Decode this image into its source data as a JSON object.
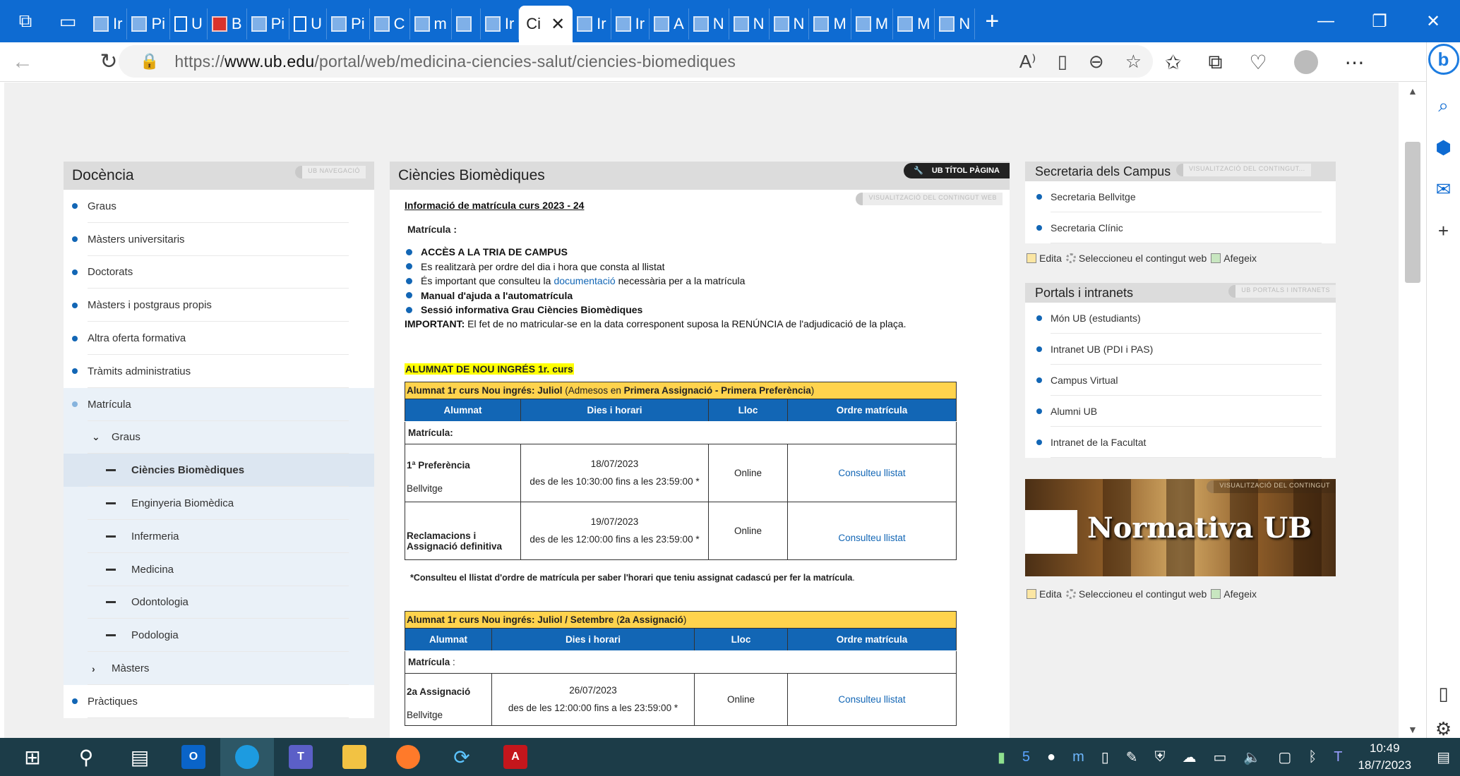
{
  "browser": {
    "tabs": [
      {
        "label": "Ir",
        "icon": "ub"
      },
      {
        "label": "Pi",
        "icon": "ub"
      },
      {
        "label": "U",
        "icon": "doc"
      },
      {
        "label": "B",
        "icon": "pdf"
      },
      {
        "label": "Pi",
        "icon": "ub"
      },
      {
        "label": "U",
        "icon": "doc"
      },
      {
        "label": "Pi",
        "icon": "ub"
      },
      {
        "label": "C",
        "icon": "app"
      },
      {
        "label": "m",
        "icon": "ub"
      },
      {
        "label": "",
        "icon": "ub"
      },
      {
        "label": "Ir",
        "icon": "ub"
      }
    ],
    "active_tab": {
      "label": "Ci",
      "close": "✕"
    },
    "tabs_after": [
      {
        "label": "Ir",
        "icon": "ub"
      },
      {
        "label": "Ir",
        "icon": "ub"
      },
      {
        "label": "A",
        "icon": "ub"
      },
      {
        "label": "N",
        "icon": "ub"
      },
      {
        "label": "N",
        "icon": "ub"
      },
      {
        "label": "N",
        "icon": "ub"
      },
      {
        "label": "M",
        "icon": "ub"
      },
      {
        "label": "M",
        "icon": "ub"
      },
      {
        "label": "M",
        "icon": "ub"
      },
      {
        "label": "N",
        "icon": "ub"
      }
    ],
    "url_domain": "www.ub.edu",
    "url_prefix": "https://",
    "url_path": "/portal/web/medicina-ciencies-salut/ciencies-biomediques"
  },
  "left": {
    "title": "Docència",
    "tag": "UB NAVEGACIÓ",
    "items": [
      {
        "label": "Graus"
      },
      {
        "label": "Màsters universitaris"
      },
      {
        "label": "Doctorats"
      },
      {
        "label": "Màsters i postgraus propis"
      },
      {
        "label": "Altra oferta formativa"
      },
      {
        "label": "Tràmits administratius"
      },
      {
        "label": "Matrícula"
      }
    ],
    "sub_graus": "Graus",
    "sub2": [
      "Ciències Biomèdiques",
      "Enginyeria Biomèdica",
      "Infermeria",
      "Medicina",
      "Odontologia",
      "Podologia"
    ],
    "sub_masters": "Màsters",
    "practiques": "Pràctiques"
  },
  "center": {
    "title": "Ciències Biomèdiques",
    "title_tag": "UB TÍTOL PÀGINA",
    "content_tag": "VISUALITZACIÓ DEL CONTINGUT WEB",
    "info_title": "Informació de matrícula curs 2023 - 24",
    "matricula_label": "Matrícula :",
    "bullets": {
      "b1": "ACCÈS A LA TRIA DE CAMPUS",
      "b2": "Es realitzarà per ordre del dia i hora que consta al llistat",
      "b3_pre": "És important que consulteu la",
      "b3_link": "documentació",
      "b3_post": "necessària per a la matrícula",
      "b4": "Manual d'ajuda a l'automatrícula",
      "b5": "Sessió informativa Grau Ciències Biomèdiques"
    },
    "important_label": "IMPORTANT:",
    "important_text": " El fet de no matricular-se en la data corresponent suposa la RENÚNCIA de l'adjudicació de la plaça.",
    "new_students": "ALUMNAT DE NOU INGRÉS 1r. curs",
    "table1": {
      "cap_bold": "Alumnat 1r curs Nou ingrés: Juliol",
      "cap_pre": " (Admesos en ",
      "cap_bold2": "Primera Assignació - Primera Preferència",
      "cap_post": ")",
      "headers": [
        "Alumnat",
        "Dies i horari",
        "Lloc",
        "Ordre matrícula"
      ],
      "matricula": "Matrícula:",
      "rows": [
        {
          "label": "1ª Preferència",
          "sub": "Bellvitge",
          "date": "18/07/2023",
          "hours": "des de les 10:30:00 fins a les 23:59:00 *",
          "place": "Online",
          "link": "Consulteu llistat"
        },
        {
          "label": "Reclamacions i Assignació definitiva",
          "sub": "",
          "date": "19/07/2023",
          "hours": "des de les 12:00:00 fins a les 23:59:00 *",
          "place": "Online",
          "link": "Consulteu llistat"
        }
      ]
    },
    "footnote_bold": "*Consulteu el llistat d'ordre de matrícula per saber l'horari que teniu assignat cadascú per fer la matrícula",
    "footnote_post": ".",
    "table2": {
      "cap_bold": "Alumnat 1r curs Nou ingrés: Juliol / Setembre",
      "cap_pre": " (",
      "cap_bold2": "2a Assignació",
      "cap_post": ")",
      "headers": [
        "Alumnat",
        "Dies i horari",
        "Lloc",
        "Ordre matrícula"
      ],
      "matricula": "Matrícula",
      "matricula_post": " :",
      "rows": [
        {
          "label": "2a Assignació",
          "sub": "Bellvitge",
          "date": "26/07/2023",
          "hours": "des de les 12:00:00 fins a les 23:59:00 *",
          "place": "Online",
          "link": "Consulteu llistat"
        }
      ]
    }
  },
  "right": {
    "box1": {
      "title": "Secretaria dels Campus",
      "tag": "VISUALITZACIÓ DEL CONTINGUT...",
      "items": [
        "Secretaria Bellvitge",
        "Secretaria Clínic"
      ]
    },
    "edit": {
      "edita": "Edita",
      "select": "Seleccioneu el contingut web",
      "add": "Afegeix"
    },
    "box2": {
      "title": "Portals i intranets",
      "tag": "UB PORTALS I INTRANETS",
      "items": [
        "Món UB (estudiants)",
        "Intranet UB (PDI i PAS)",
        "Campus Virtual",
        "Alumni UB",
        "Intranet de la Facultat"
      ]
    },
    "banner": {
      "title": "Normativa UB",
      "tag": "VISUALITZACIÓ DEL CONTINGUT"
    }
  },
  "taskbar": {
    "time": "10:49",
    "date": "18/7/2023"
  },
  "colors": {
    "accent": "#0e6bd2",
    "ub_blue": "#1266b5",
    "yellow": "#ffd34d",
    "highlight": "#ffff00"
  }
}
